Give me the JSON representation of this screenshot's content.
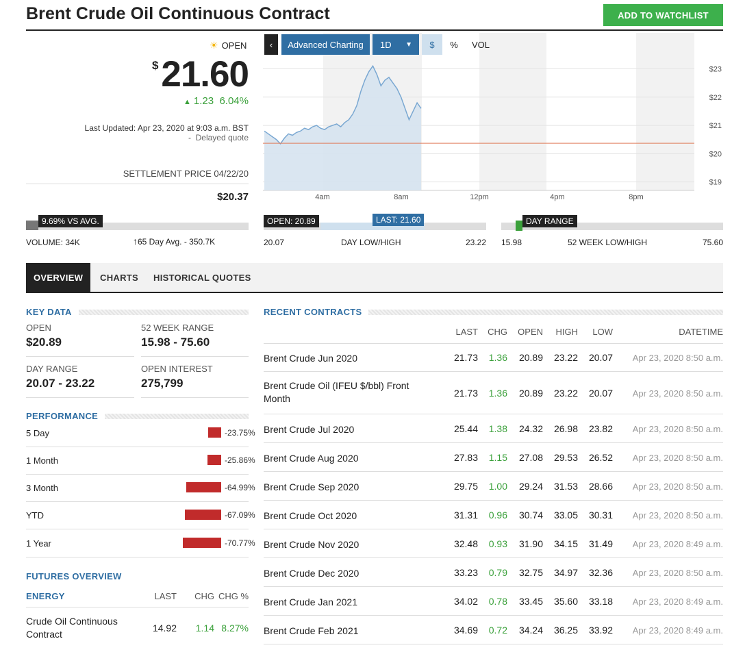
{
  "header": {
    "title": "Brent Crude Oil Continuous Contract",
    "watchlist_label": "ADD TO WATCHLIST"
  },
  "quote": {
    "status": "OPEN",
    "currency_symbol": "$",
    "price": "21.60",
    "change": "1.23",
    "change_pct": "6.04%",
    "last_updated": "Last Updated: Apr 23, 2020 at 9:03 a.m. BST",
    "delayed": "Delayed quote",
    "settlement_label": "SETTLEMENT PRICE 04/22/20",
    "settlement_value": "$20.37"
  },
  "chart_toolbar": {
    "advanced": "Advanced Charting",
    "range": "1D",
    "dollar": "$",
    "pct": "%",
    "vol": "VOL"
  },
  "chart_data": {
    "type": "line",
    "x_ticks": [
      "4am",
      "8am",
      "12pm",
      "4pm",
      "8pm"
    ],
    "y_ticks": [
      "$23",
      "$22",
      "$21",
      "$20",
      "$19"
    ],
    "ylim": [
      18.7,
      23.4
    ],
    "reference_line": 20.37,
    "series": [
      {
        "values": [
          20.8,
          20.7,
          20.6,
          20.5,
          20.35,
          20.55,
          20.7,
          20.65,
          20.75,
          20.8,
          20.9,
          20.85,
          20.95,
          21.0,
          20.9,
          20.85,
          20.95,
          21.0,
          21.05,
          20.95,
          21.1,
          21.2,
          21.4,
          21.7,
          22.2,
          22.6,
          22.9,
          23.1,
          22.8,
          22.4,
          22.6,
          22.7,
          22.5,
          22.3,
          22.0,
          21.6,
          21.2,
          21.5,
          21.8,
          21.6
        ]
      }
    ],
    "grid": true
  },
  "ranges": {
    "volume": {
      "flag": "9.69% VS AVG.",
      "volume": "VOLUME: 34K",
      "avg": "65 Day Avg. - 350.7K"
    },
    "day": {
      "open_flag": "OPEN: 20.89",
      "last_flag": "LAST: 21.60",
      "low": "20.07",
      "label": "DAY LOW/HIGH",
      "high": "23.22"
    },
    "week52": {
      "flag": "DAY RANGE",
      "low": "15.98",
      "label": "52 WEEK LOW/HIGH",
      "high": "75.60"
    }
  },
  "tabs": [
    "OVERVIEW",
    "CHARTS",
    "HISTORICAL QUOTES"
  ],
  "key_data": {
    "title": "KEY DATA",
    "open_label": "OPEN",
    "open_value": "$20.89",
    "range52_label": "52 WEEK RANGE",
    "range52_value": "15.98 - 75.60",
    "dayrange_label": "DAY RANGE",
    "dayrange_value": "20.07 - 23.22",
    "oi_label": "OPEN INTEREST",
    "oi_value": "275,799"
  },
  "performance": {
    "title": "PERFORMANCE",
    "rows": [
      {
        "label": "5 Day",
        "value": "-23.75%",
        "pct": 23.75
      },
      {
        "label": "1 Month",
        "value": "-25.86%",
        "pct": 25.86
      },
      {
        "label": "3 Month",
        "value": "-64.99%",
        "pct": 64.99
      },
      {
        "label": "YTD",
        "value": "-67.09%",
        "pct": 67.09
      },
      {
        "label": "1 Year",
        "value": "-70.77%",
        "pct": 70.77
      }
    ]
  },
  "futures": {
    "title": "FUTURES OVERVIEW",
    "cols": [
      "ENERGY",
      "LAST",
      "CHG",
      "CHG %"
    ],
    "rows": [
      {
        "name": "Crude Oil Continuous Contract",
        "last": "14.92",
        "chg": "1.14",
        "chg_pct": "8.27%"
      }
    ]
  },
  "contracts": {
    "title": "RECENT CONTRACTS",
    "cols": [
      "LAST",
      "CHG",
      "OPEN",
      "HIGH",
      "LOW",
      "DATETIME"
    ],
    "rows": [
      {
        "name": "Brent Crude Jun 2020",
        "last": "21.73",
        "chg": "1.36",
        "open": "20.89",
        "high": "23.22",
        "low": "20.07",
        "dt": "Apr 23, 2020 8:50 a.m."
      },
      {
        "name": "Brent Crude Oil (IFEU $/bbl) Front Month",
        "last": "21.73",
        "chg": "1.36",
        "open": "20.89",
        "high": "23.22",
        "low": "20.07",
        "dt": "Apr 23, 2020 8:50 a.m."
      },
      {
        "name": "Brent Crude Jul 2020",
        "last": "25.44",
        "chg": "1.38",
        "open": "24.32",
        "high": "26.98",
        "low": "23.82",
        "dt": "Apr 23, 2020 8:50 a.m."
      },
      {
        "name": "Brent Crude Aug 2020",
        "last": "27.83",
        "chg": "1.15",
        "open": "27.08",
        "high": "29.53",
        "low": "26.52",
        "dt": "Apr 23, 2020 8:50 a.m."
      },
      {
        "name": "Brent Crude Sep 2020",
        "last": "29.75",
        "chg": "1.00",
        "open": "29.24",
        "high": "31.53",
        "low": "28.66",
        "dt": "Apr 23, 2020 8:50 a.m."
      },
      {
        "name": "Brent Crude Oct 2020",
        "last": "31.31",
        "chg": "0.96",
        "open": "30.74",
        "high": "33.05",
        "low": "30.31",
        "dt": "Apr 23, 2020 8:50 a.m."
      },
      {
        "name": "Brent Crude Nov 2020",
        "last": "32.48",
        "chg": "0.93",
        "open": "31.90",
        "high": "34.15",
        "low": "31.49",
        "dt": "Apr 23, 2020 8:49 a.m."
      },
      {
        "name": "Brent Crude Dec 2020",
        "last": "33.23",
        "chg": "0.79",
        "open": "32.75",
        "high": "34.97",
        "low": "32.36",
        "dt": "Apr 23, 2020 8:50 a.m."
      },
      {
        "name": "Brent Crude Jan 2021",
        "last": "34.02",
        "chg": "0.78",
        "open": "33.45",
        "high": "35.60",
        "low": "33.18",
        "dt": "Apr 23, 2020 8:49 a.m."
      },
      {
        "name": "Brent Crude Feb 2021",
        "last": "34.69",
        "chg": "0.72",
        "open": "34.24",
        "high": "36.25",
        "low": "33.92",
        "dt": "Apr 23, 2020 8:49 a.m."
      }
    ]
  },
  "colors": {
    "accent": "#2f6ea3",
    "positive": "#3aa03a",
    "negative": "#c12b2b",
    "watch_button": "#3db04c"
  }
}
